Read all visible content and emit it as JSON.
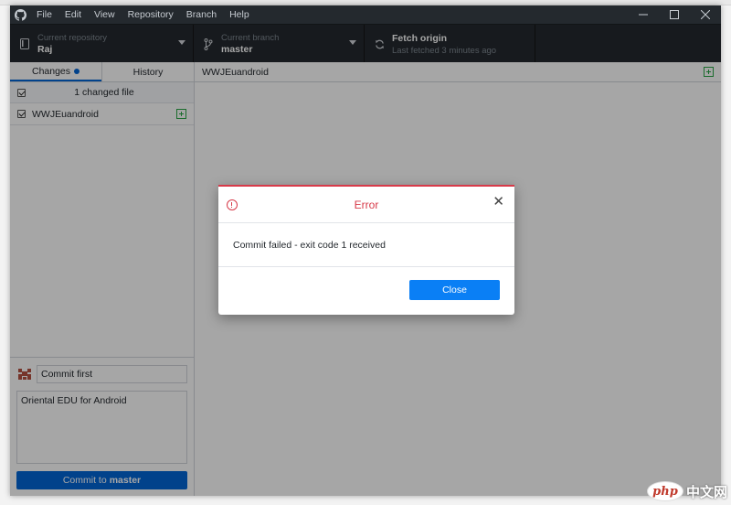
{
  "menu": {
    "items": [
      "File",
      "Edit",
      "View",
      "Repository",
      "Branch",
      "Help"
    ]
  },
  "toolbar": {
    "repository": {
      "label": "Current repository",
      "value": "Raj"
    },
    "branch": {
      "label": "Current branch",
      "value": "master"
    },
    "fetch": {
      "label": "Fetch origin",
      "sub": "Last fetched 3 minutes ago"
    }
  },
  "sidebar": {
    "tabs": [
      {
        "label": "Changes"
      },
      {
        "label": "History"
      }
    ],
    "changed_count": "1 changed file",
    "files": [
      {
        "name": "WWJEuandroid"
      }
    ],
    "commit": {
      "summary": "Commit first",
      "description": "Oriental EDU for Android",
      "button_prefix": "Commit to",
      "button_branch": "master"
    }
  },
  "content": {
    "path": "WWJEuandroid"
  },
  "dialog": {
    "title": "Error",
    "message": "Commit failed - exit code 1 received",
    "close_label": "Close"
  },
  "watermark": {
    "php": "php",
    "cn": "中文网"
  },
  "colors": {
    "titlebar": "#24292e",
    "accent": "#0366d6",
    "error": "#d73a49",
    "added": "#28a745"
  },
  "icons": {
    "logo": "github-logo-icon",
    "repo": "repo-icon",
    "branch": "git-branch-icon",
    "fetch": "sync-icon",
    "error": "alert-circle-icon",
    "close": "x-icon",
    "added": "diff-added-icon"
  }
}
